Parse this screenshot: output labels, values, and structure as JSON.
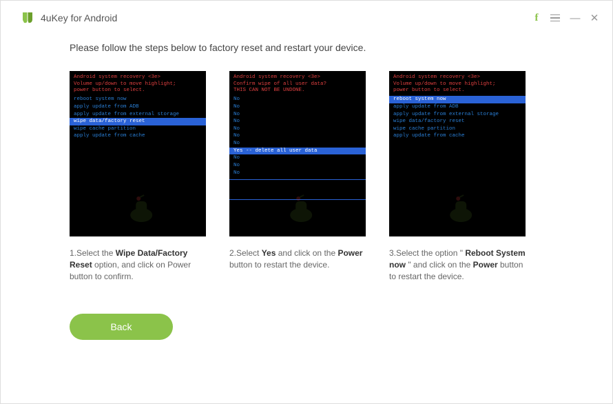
{
  "app": {
    "title": "4uKey for Android"
  },
  "instruction": "Please follow the steps below to factory reset and restart your device.",
  "screens": {
    "header": "Android system recovery <3e>",
    "s1": {
      "sub": "Volume up/down to move highlight;\npower button to select.",
      "items": [
        "reboot system now",
        "apply update from ADB",
        "apply update from external storage",
        "wipe data/factory reset",
        "wipe cache partition",
        "apply update from cache"
      ],
      "selectedIndex": 3
    },
    "s2": {
      "sub": "Confirm wipe of all user data?\nTHIS CAN NOT BE UNDONE.",
      "items": [
        "No",
        "No",
        "No",
        "No",
        "No",
        "No",
        "No",
        "Yes -- delete all user data",
        "No",
        "No",
        "No"
      ],
      "selectedIndex": 7
    },
    "s3": {
      "sub": "Volume up/down to move highlight;\npower button to select.",
      "items": [
        "reboot system now",
        "apply update from ADB",
        "apply update from external storage",
        "wipe data/factory reset",
        "wipe cache partition",
        "apply update from cache"
      ],
      "selectedIndex": 0
    }
  },
  "steps": {
    "s1": {
      "prefix": "1.Select the ",
      "bold": "Wipe Data/Factory Reset",
      "suffix": " option, and click on Power button to confirm."
    },
    "s2": {
      "prefix": "2.Select ",
      "bold": "Yes",
      "mid": " and click on the ",
      "bold2": "Power",
      "suffix": " button to restart the device."
    },
    "s3": {
      "prefix": "3.Select the option \" ",
      "bold": "Reboot System now",
      "mid": " \" and click on the ",
      "bold2": "Power",
      "suffix": " button to restart the device."
    }
  },
  "buttons": {
    "back": "Back"
  }
}
